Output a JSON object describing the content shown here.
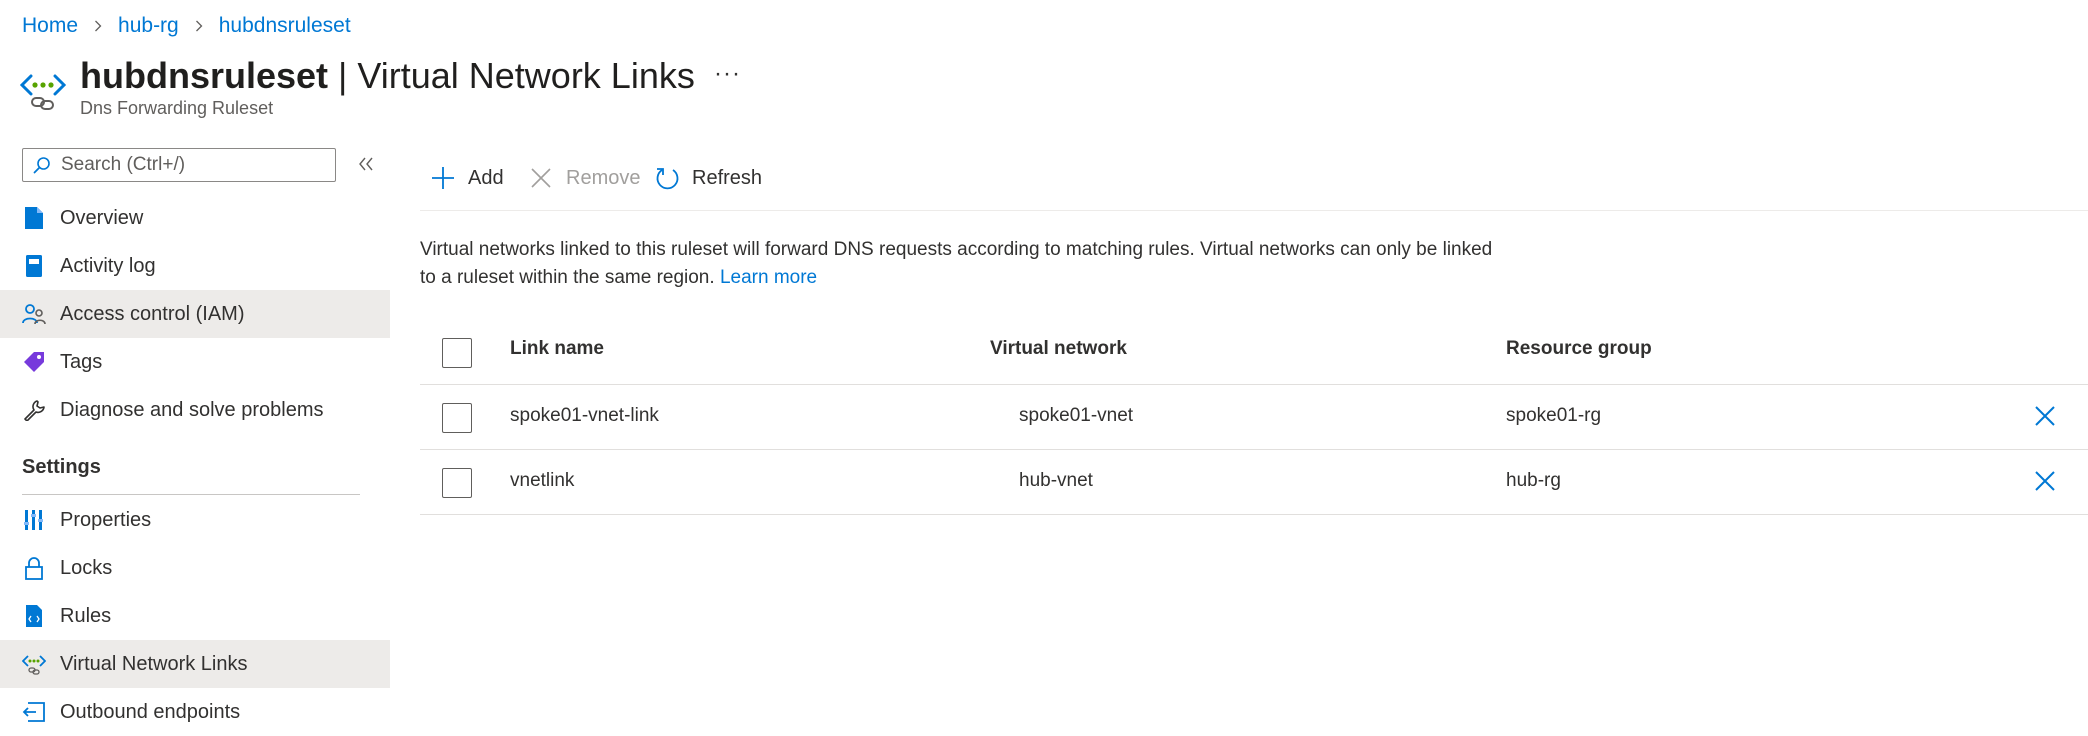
{
  "breadcrumb": {
    "home": "Home",
    "resource_group": "hub-rg",
    "resource": "hubdnsruleset"
  },
  "header": {
    "resource_name": "hubdnsruleset",
    "separator_and_page": " | Virtual Network Links",
    "more": "···",
    "subtitle": "Dns Forwarding Ruleset"
  },
  "sidebar": {
    "search_placeholder": "Search (Ctrl+/)",
    "collapse_icon": "double-chevron-left-icon",
    "items": [
      {
        "label": "Overview",
        "icon": "overview-icon"
      },
      {
        "label": "Activity log",
        "icon": "activity-log-icon"
      },
      {
        "label": "Access control (IAM)",
        "icon": "iam-icon"
      },
      {
        "label": "Tags",
        "icon": "tag-icon"
      },
      {
        "label": "Diagnose and solve problems",
        "icon": "wrench-icon"
      }
    ],
    "settings_heading": "Settings",
    "settings_items": [
      {
        "label": "Properties",
        "icon": "properties-icon"
      },
      {
        "label": "Locks",
        "icon": "lock-icon"
      },
      {
        "label": "Rules",
        "icon": "rules-icon"
      },
      {
        "label": "Virtual Network Links",
        "icon": "vnet-link-icon"
      },
      {
        "label": "Outbound endpoints",
        "icon": "outbound-endpoint-icon"
      }
    ],
    "selected": [
      "Access control (IAM)",
      "Virtual Network Links"
    ]
  },
  "toolbar": {
    "add": "Add",
    "remove": "Remove",
    "refresh": "Refresh"
  },
  "description": {
    "text": "Virtual networks linked to this ruleset will forward DNS requests according to matching rules. Virtual networks can only be linked to a ruleset within the same region.",
    "learn_more": "Learn more"
  },
  "table": {
    "columns": [
      "Link name",
      "Virtual network",
      "Resource group"
    ],
    "rows": [
      {
        "link_name": "spoke01-vnet-link",
        "virtual_network": "spoke01-vnet",
        "resource_group": "spoke01-rg"
      },
      {
        "link_name": "vnetlink",
        "virtual_network": "hub-vnet",
        "resource_group": "hub-rg"
      }
    ]
  },
  "colors": {
    "accent": "#0078d4",
    "text": "#323130",
    "selected_bg": "#edebe9",
    "disabled": "#a19f9d"
  }
}
